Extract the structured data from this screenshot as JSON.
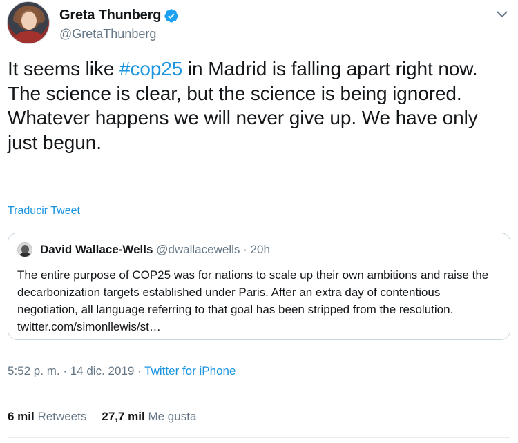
{
  "author": {
    "display_name": "Greta Thunberg",
    "handle": "@GretaThunberg",
    "verified_icon": "verified-badge-icon"
  },
  "tweet": {
    "line1_pre": "It seems like ",
    "hashtag": "#cop25",
    "line1_post": " in Madrid is falling apart right now. The science is clear, but the science is being ignored.",
    "paragraph2": "Whatever happens we will never give up. We have only just begun."
  },
  "translate_link": "Traducir Tweet",
  "quoted_tweet": {
    "name": "David Wallace-Wells",
    "handle": "@dwallacewells",
    "separator": "·",
    "time": "20h",
    "text": "The entire purpose of COP25 was for nations to scale up their own ambitions and raise the decarbonization targets established under Paris. After an extra day of contentious negotiation, all language referring to that goal has been stripped from the resolution. twitter.com/simonllewis/st…"
  },
  "meta": {
    "time": "5:52 p. m.",
    "sep1": " · ",
    "date": "14 dic. 2019",
    "sep2": " · ",
    "source": "Twitter for iPhone"
  },
  "stats": {
    "retweets_count": "6 mil",
    "retweets_label": "Retweets",
    "likes_count": "27,7 mil",
    "likes_label": "Me gusta"
  },
  "colors": {
    "accent": "#1b95e0",
    "text": "#14171a",
    "secondary": "#657786",
    "border": "#ccd6dd"
  }
}
